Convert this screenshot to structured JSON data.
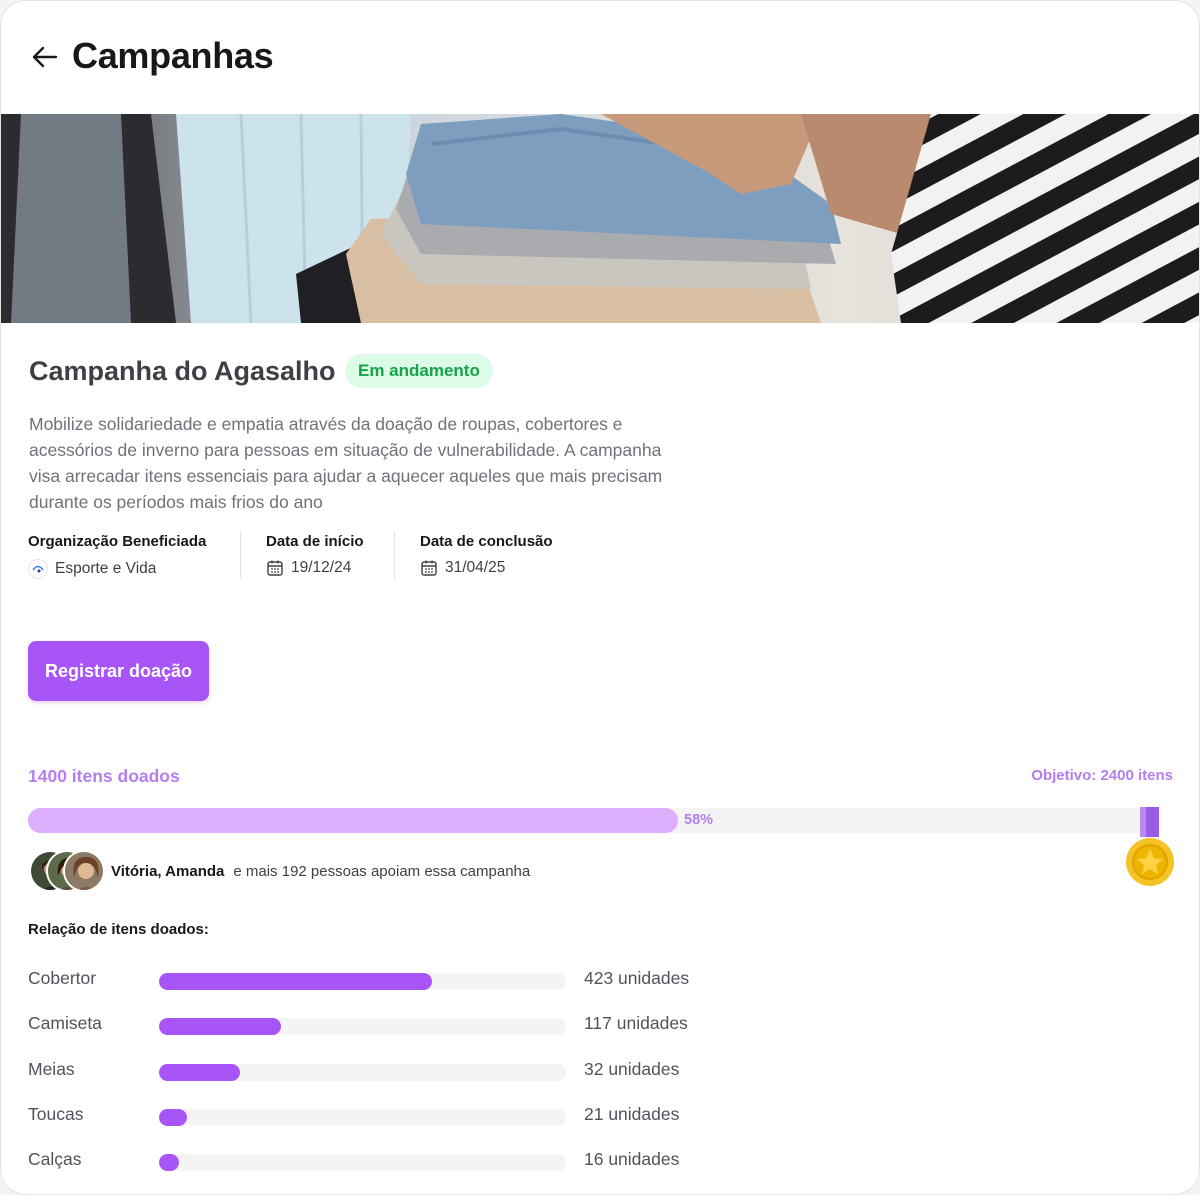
{
  "header": {
    "title": "Campanhas",
    "back_icon": "arrow-left-icon"
  },
  "campaign": {
    "title": "Campanha do Agasalho",
    "status": "Em andamento",
    "status_color": "#16a34a",
    "description": "Mobilize solidariedade e empatia através da doação de roupas, cobertores e acessórios de inverno para pessoas em situação de vulnerabilidade. A campanha visa arrecadar itens essenciais para ajudar a aquecer aqueles que mais precisam durante os períodos mais frios do ano",
    "meta": {
      "org_label": "Organização Beneficiada",
      "org_value": "Esporte e Vida",
      "start_label": "Data de início",
      "start_value": "19/12/24",
      "end_label": "Data de conclusão",
      "end_value": "31/04/25"
    },
    "donate_button": "Registrar doação",
    "accent_color": "#a855f7"
  },
  "progress": {
    "donated_label": "1400 itens doados",
    "goal_label": "Objetivo: 2400 itens",
    "percent_label": "58%",
    "fraction": 0.58,
    "medal_icon": "gold-medal-icon"
  },
  "supporters": {
    "names": "Vitória, Amanda",
    "text": "e mais 192 pessoas apoiam essa campanha",
    "avatar_count": 3
  },
  "items": {
    "heading": "Relação de itens doados:",
    "rows": [
      {
        "name": "Cobertor",
        "qty": "423 unidades",
        "fraction": 0.67
      },
      {
        "name": "Camiseta",
        "qty": "117 unidades",
        "fraction": 0.3
      },
      {
        "name": "Meias",
        "qty": "32 unidades",
        "fraction": 0.2
      },
      {
        "name": "Toucas",
        "qty": "21 unidades",
        "fraction": 0.07
      },
      {
        "name": "Calças",
        "qty": "16 unidades",
        "fraction": 0.05
      }
    ]
  }
}
